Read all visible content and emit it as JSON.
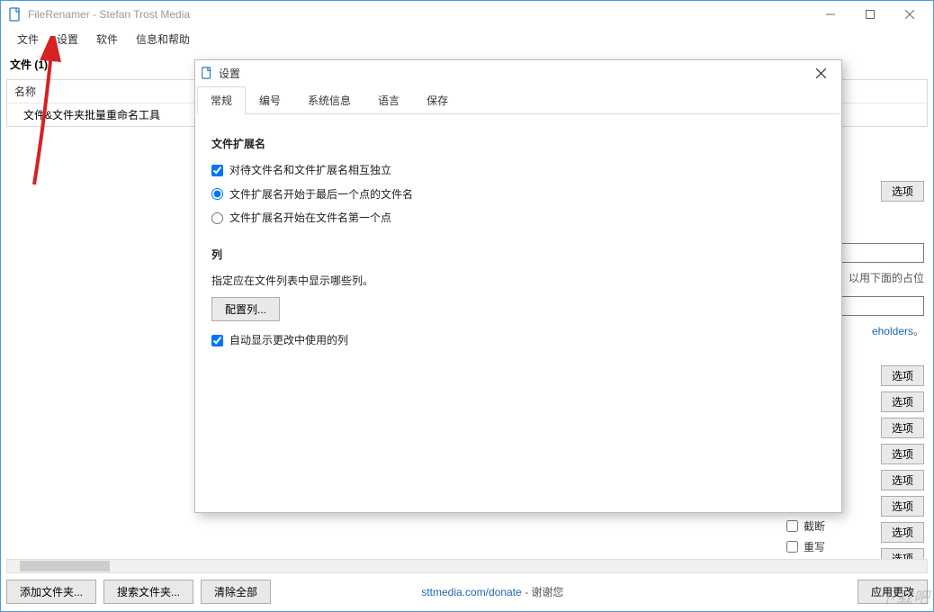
{
  "window": {
    "title": "FileRenamer - Stefan Trost Media"
  },
  "menubar": [
    "文件",
    "设置",
    "软件",
    "信息和帮助"
  ],
  "files": {
    "header": "文件 (1)",
    "column_name": "名称",
    "row0": "文件&文件夹批量重命名工具"
  },
  "bottom": {
    "add_folder": "添加文件夹...",
    "search_files": "搜索文件夹...",
    "clear_all": "清除全部",
    "donate_text": "sttmedia.com/donate",
    "thanks": " - 谢谢您",
    "apply": "应用更改"
  },
  "side": {
    "option": "选项",
    "hint1": "以用下面的占位",
    "link": "eholders",
    "trunc": "截断",
    "rewrite": "重写"
  },
  "dialog": {
    "title": "设置",
    "tabs": {
      "general": "常规",
      "number": "编号",
      "sysinfo": "系统信息",
      "lang": "语言",
      "save": "保存"
    },
    "sec_ext": "文件扩展名",
    "cb_independent": "对待文件名和文件扩展名相互独立",
    "rb_last_dot": "文件扩展名开始于最后一个点的文件名",
    "rb_first_dot": "文件扩展名开始在文件名第一个点",
    "sec_cols": "列",
    "cols_desc": "指定应在文件列表中显示哪些列。",
    "btn_cols": "配置列...",
    "cb_auto_cols": "自动显示更改中使用的列"
  },
  "watermark": "下载吧"
}
